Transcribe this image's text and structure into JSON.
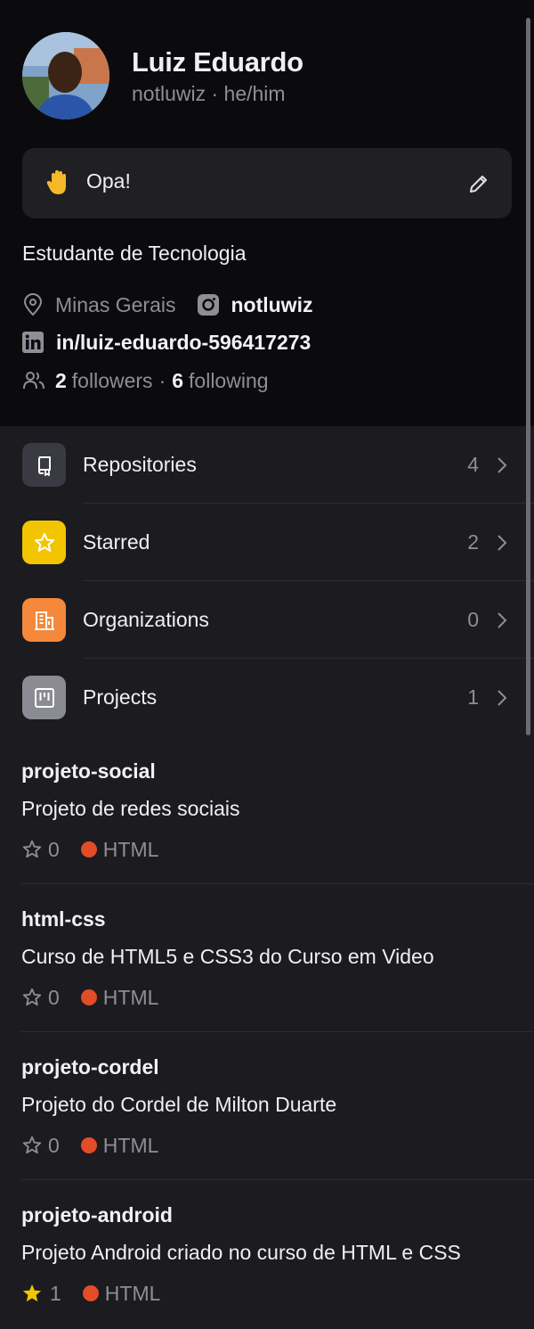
{
  "profile": {
    "name": "Luiz Eduardo",
    "handle": "notluwiz · he/him",
    "status_text": "Opa!",
    "status_emoji": "raised-hand-emoji",
    "bio": "Estudante de Tecnologia",
    "location": "Minas Gerais",
    "instagram": "notluwiz",
    "linkedin": "in/luiz-eduardo-596417273",
    "followers_count": "2",
    "followers_label": "followers",
    "separator": "·",
    "following_count": "6",
    "following_label": "following"
  },
  "menu": [
    {
      "label": "Repositories",
      "count": "4",
      "icon": "repo-icon",
      "color": "#3a3a42"
    },
    {
      "label": "Starred",
      "count": "2",
      "icon": "star-icon",
      "color": "#f2c500"
    },
    {
      "label": "Organizations",
      "count": "0",
      "icon": "organization-icon",
      "color": "#f5883a"
    },
    {
      "label": "Projects",
      "count": "1",
      "icon": "project-board-icon",
      "color": "#8b8b93"
    }
  ],
  "repos": [
    {
      "name": "projeto-social",
      "description": "Projeto de redes sociais",
      "stars": "0",
      "starred": false,
      "language": "HTML",
      "language_color": "#e34c26"
    },
    {
      "name": "html-css",
      "description": "Curso de HTML5 e CSS3 do Curso em Video",
      "stars": "0",
      "starred": false,
      "language": "HTML",
      "language_color": "#e34c26"
    },
    {
      "name": "projeto-cordel",
      "description": "Projeto do Cordel de Milton Duarte",
      "stars": "0",
      "starred": false,
      "language": "HTML",
      "language_color": "#e34c26"
    },
    {
      "name": "projeto-android",
      "description": "Projeto Android criado no curso de HTML e CSS",
      "stars": "1",
      "starred": true,
      "language": "HTML",
      "language_color": "#e34c26"
    }
  ],
  "colors": {
    "background": "#0b0b0e",
    "surface": "#1b1b20",
    "accent_star": "#f2c500"
  }
}
